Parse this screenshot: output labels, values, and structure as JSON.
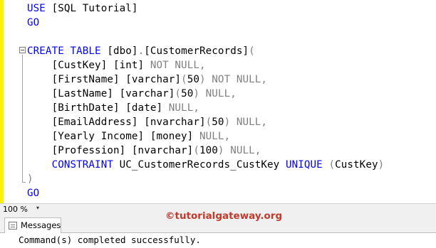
{
  "editor": {
    "lines": [
      [
        {
          "t": "USE ",
          "c": "kw"
        },
        {
          "t": "[SQL Tutorial]",
          "c": "pl"
        }
      ],
      [
        {
          "t": "GO",
          "c": "kw"
        }
      ],
      [],
      [
        {
          "t": "CREATE TABLE ",
          "c": "kw"
        },
        {
          "t": "[dbo]",
          "c": "pl"
        },
        {
          "t": ".",
          "c": "gr"
        },
        {
          "t": "[CustomerRecords]",
          "c": "pl"
        },
        {
          "t": "(",
          "c": "gr"
        }
      ],
      [
        {
          "t": "    [CustKey] [int] ",
          "c": "pl"
        },
        {
          "t": "NOT NULL,",
          "c": "gr"
        }
      ],
      [
        {
          "t": "    [FirstName] [varchar]",
          "c": "pl"
        },
        {
          "t": "(",
          "c": "gr"
        },
        {
          "t": "50",
          "c": "pl"
        },
        {
          "t": ") NOT NULL,",
          "c": "gr"
        }
      ],
      [
        {
          "t": "    [LastName] [varchar]",
          "c": "pl"
        },
        {
          "t": "(",
          "c": "gr"
        },
        {
          "t": "50",
          "c": "pl"
        },
        {
          "t": ") NULL,",
          "c": "gr"
        }
      ],
      [
        {
          "t": "    [BirthDate] [date] ",
          "c": "pl"
        },
        {
          "t": "NULL,",
          "c": "gr"
        }
      ],
      [
        {
          "t": "    [EmailAddress] [nvarchar]",
          "c": "pl"
        },
        {
          "t": "(",
          "c": "gr"
        },
        {
          "t": "50",
          "c": "pl"
        },
        {
          "t": ") NULL,",
          "c": "gr"
        }
      ],
      [
        {
          "t": "    [Yearly Income] [money] ",
          "c": "pl"
        },
        {
          "t": "NULL,",
          "c": "gr"
        }
      ],
      [
        {
          "t": "    [Profession] [nvarchar]",
          "c": "pl"
        },
        {
          "t": "(",
          "c": "gr"
        },
        {
          "t": "100",
          "c": "pl"
        },
        {
          "t": ") NULL,",
          "c": "gr"
        }
      ],
      [
        {
          "t": "    CONSTRAINT ",
          "c": "kw"
        },
        {
          "t": "UC_CustomerRecords_CustKey ",
          "c": "pl"
        },
        {
          "t": "UNIQUE ",
          "c": "kw"
        },
        {
          "t": "(",
          "c": "gr"
        },
        {
          "t": "CustKey",
          "c": "pl"
        },
        {
          "t": ")",
          "c": "gr"
        }
      ],
      [
        {
          "t": ")",
          "c": "gr"
        }
      ],
      [
        {
          "t": "GO",
          "c": "kw"
        }
      ]
    ]
  },
  "status_bar": {
    "zoom": "100 %",
    "zoom_arrow": "▾"
  },
  "watermark": "©tutorialgateway.org",
  "results": {
    "tab_label": "Messages",
    "message": "Command(s) completed successfully."
  },
  "colors": {
    "keyword": "#0000ff",
    "gray": "#808080",
    "watermark": "#c0392b",
    "gutter": "#fff200"
  }
}
